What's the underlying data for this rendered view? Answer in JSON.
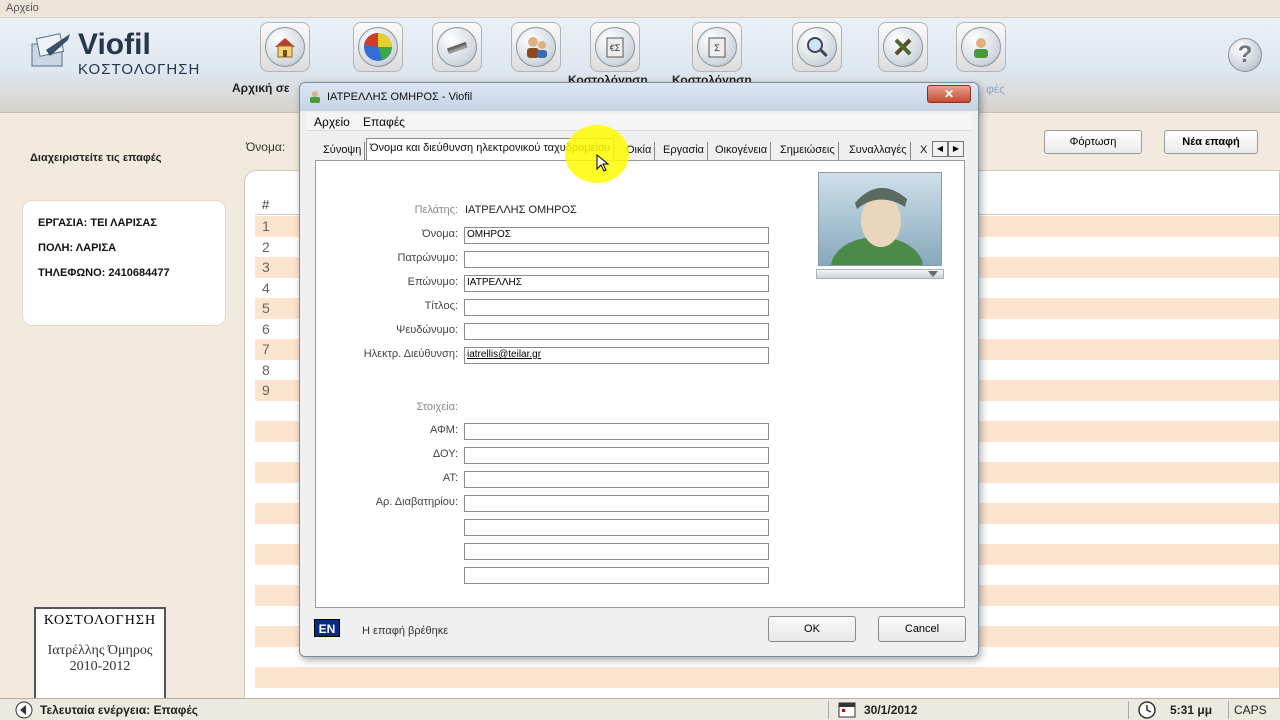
{
  "menubar": {
    "file": "Αρχείο"
  },
  "app": {
    "title": "Viofil",
    "subtitle": "ΚΟΣΤΟΛΟΓΗΣΗ"
  },
  "toolbar": {
    "buttons": [
      {
        "icon": "home-icon",
        "label": "Αρχική σε"
      },
      {
        "icon": "chart-icon",
        "label": ""
      },
      {
        "icon": "tools-icon",
        "label": ""
      },
      {
        "icon": "contacts-icon",
        "label": ""
      },
      {
        "icon": "calc-icon",
        "label": "Κοστολόγηση"
      },
      {
        "icon": "calc2-icon",
        "label": "Κοστολόγηση"
      },
      {
        "icon": "search-icon",
        "label": ""
      },
      {
        "icon": "settings-icon",
        "label": ""
      },
      {
        "icon": "user-icon",
        "label": "φές"
      }
    ]
  },
  "left": {
    "title": "Διαχειριστείτε τις επαφές",
    "info": [
      "ΕΡΓΑΣΙΑ: ΤΕΙ ΛΑΡΙΣΑΣ",
      "ΠΟΛΗ: ΛΑΡΙΣΑ",
      "ΤΗΛΕΦΩΝΟ: 2410684477"
    ],
    "stamp": {
      "line1": "ΚΟΣΤΟΛΟΓΗΣΗ",
      "line2": "Ιατρέλλης Όμηρος",
      "line3": "2010-2012"
    }
  },
  "search": {
    "label": "Όνομα:"
  },
  "actions": {
    "load": "Φόρτωση",
    "new_contact": "Νέα επαφή"
  },
  "list": {
    "header": "#",
    "rows": [
      "1",
      "2",
      "3",
      "4",
      "5",
      "6",
      "7",
      "8",
      "9",
      "",
      "",
      "",
      "",
      "",
      "",
      "",
      "",
      "",
      "",
      "",
      "",
      "",
      "",
      ""
    ]
  },
  "dialog": {
    "title": "ΙΑΤΡΕΛΛΗΣ ΟΜΗΡΟΣ - Viofil",
    "close_symbol": "✕",
    "menu": {
      "file": "Αρχείο",
      "contacts": "Επαφές"
    },
    "tabs": [
      "Σύνοψη",
      "Όνομα και διεύθυνση ηλεκτρονικού ταχυδρομείου",
      "Οικία",
      "Εργασία",
      "Οικογένεια",
      "Σημειώσεις",
      "Συναλλαγές",
      "Χ"
    ],
    "tab_prev": "◀",
    "tab_next": "▶",
    "form": {
      "client_label": "Πελάτης:",
      "client_value": "ΙΑΤΡΕΛΛΗΣ ΟΜΗΡΟΣ",
      "name_label": "Όνομα:",
      "name_value": "ΟΜΗΡΟΣ",
      "patronymic_label": "Πατρώνυμο:",
      "patronymic_value": "",
      "surname_label": "Επώνυμο:",
      "surname_value": "ΙΑΤΡΕΛΛΗΣ",
      "title_label": "Τίτλος:",
      "title_value": "",
      "nickname_label": "Ψευδώνυμο:",
      "nickname_value": "",
      "email_label": "Ηλεκτρ. Διεύθυνση:",
      "email_value": "iatrellis@teilar.gr",
      "details_label": "Στοιχεία:",
      "afm_label": "ΑΦΜ:",
      "afm_value": "",
      "doy_label": "ΔΟΥ:",
      "doy_value": "",
      "at_label": "ΑΤ:",
      "at_value": "",
      "passport_label": "Αρ. Διαβατηρίου:",
      "passport_value": "",
      "extra1": "",
      "extra2": "",
      "extra3": ""
    },
    "lang": "EN",
    "status": "Η επαφή βρέθηκε",
    "ok": "OK",
    "cancel": "Cancel"
  },
  "statusbar": {
    "last_action": "Τελευταία ενέργεια: Επαφές",
    "date": "30/1/2012",
    "time": "5:31 μμ",
    "caps": "CAPS"
  },
  "colors": {
    "row_alt": "#fde4cf",
    "brand_text": "#27364d",
    "lang_badge": "#0a2a8a",
    "cursor_highlight": "#fffa00"
  }
}
